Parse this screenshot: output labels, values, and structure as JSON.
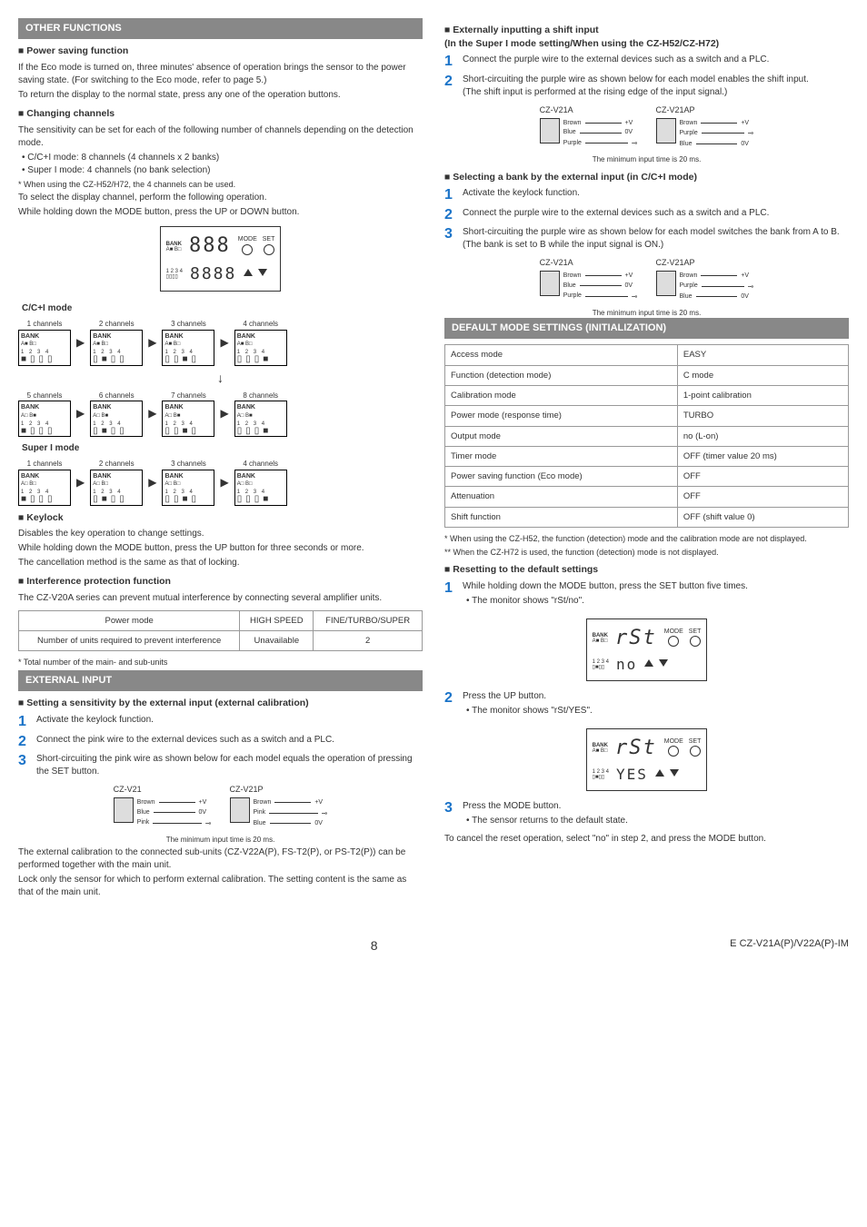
{
  "left": {
    "other_functions": "OTHER FUNCTIONS",
    "power_saving": {
      "title": "Power saving function",
      "p1": "If the Eco mode is turned on, three minutes' absence of operation brings the sensor to the power saving state. (For switching to the Eco mode, refer to page 5.)",
      "p2": "To return the display to the normal state, press any one of the operation buttons."
    },
    "changing_channels": {
      "title": "Changing channels",
      "p1": "The sensitivity can be set for each of the following number of channels depending on the detection mode.",
      "bullets": [
        "C/C+I mode: 8 channels (4 channels x 2 banks)",
        "Super I mode: 4 channels (no bank selection)"
      ],
      "note": "* When using the CZ-H52/H72, the 4 channels can be used.",
      "p2": "To select the display channel, perform the following operation.",
      "p3": "While holding down the MODE button, press the UP or DOWN button.",
      "cci_mode": "C/C+I mode",
      "super_mode": "Super I mode",
      "ch1": "1 channels",
      "ch2": "2 channels",
      "ch3": "3 channels",
      "ch4": "4 channels",
      "ch5": "5 channels",
      "ch6": "6 channels",
      "ch7": "7 channels",
      "ch8": "8 channels",
      "bank": "BANK"
    },
    "keylock": {
      "title": "Keylock",
      "p1": "Disables the key operation to change settings.",
      "p2": "While holding down the MODE button, press the UP button for three seconds or more.",
      "p3": "The cancellation method is the same as that of locking."
    },
    "interference": {
      "title": "Interference protection function",
      "p1": "The CZ-V20A series can prevent mutual interference by connecting several amplifier units.",
      "table": {
        "h1": "Power mode",
        "h2": "HIGH SPEED",
        "h3": "FINE/TURBO/SUPER",
        "r1c1": "Number of units required to prevent interference",
        "r1c2": "Unavailable",
        "r1c3": "2"
      },
      "note": "* Total number of the main- and sub-units"
    },
    "external_input": "EXTERNAL INPUT",
    "setting_sens": {
      "title": "Setting a sensitivity by the external input (external calibration)",
      "s1": "Activate the keylock function.",
      "s2": "Connect the pink wire to the external devices such as a switch and a PLC.",
      "s3": "Short-circuiting the pink wire as shown below for each model equals the operation of pressing the SET button.",
      "wiring": {
        "left_title": "CZ-V21",
        "right_title": "CZ-V21P",
        "brown": "Brown",
        "blue": "Blue",
        "pink": "Pink",
        "plusv": "+V",
        "zerov": "0V",
        "min_time": "The minimum input time is 20 ms."
      },
      "p_after": "The external calibration to the connected sub-units (CZ-V22A(P), FS-T2(P), or PS-T2(P)) can be performed together with the main unit.",
      "p_after2": "Lock only the sensor for which to perform external calibration. The setting content is the same as that of the main unit."
    }
  },
  "right": {
    "ext_shift": {
      "title": "Externally inputting a shift input",
      "subtitle": "(In the Super I mode setting/When using the CZ-H52/CZ-H72)",
      "s1": "Connect the purple wire to the external devices such as a switch and a PLC.",
      "s2": "Short-circuiting the purple wire as shown below for each model enables the shift input.",
      "s2_note": "(The shift input is performed at the rising edge of the input signal.)",
      "wiring": {
        "left_title": "CZ-V21A",
        "right_title": "CZ-V21AP",
        "brown": "Brown",
        "blue": "Blue",
        "purple": "Purple",
        "plusv": "+V",
        "zerov": "0V",
        "min_time": "The minimum input time is 20 ms."
      }
    },
    "select_bank": {
      "title": "Selecting a bank by the external input (in C/C+I mode)",
      "s1": "Activate the keylock function.",
      "s2": "Connect the purple wire to the external devices such as a switch and a PLC.",
      "s3": "Short-circuiting the purple wire as shown below for each model switches the bank from A to B.",
      "s3_note": "(The bank is set to B while the input signal is ON.)",
      "wiring": {
        "left_title": "CZ-V21A",
        "right_title": "CZ-V21AP",
        "brown": "Brown",
        "blue": "Blue",
        "purple": "Purple",
        "plusv": "+V",
        "zerov": "0V",
        "min_time": "The minimum input time is 20 ms."
      }
    },
    "defaults": {
      "header": "DEFAULT MODE SETTINGS (INITIALIZATION)",
      "rows": [
        [
          "Access mode",
          "EASY"
        ],
        [
          "Function (detection mode)",
          "C mode"
        ],
        [
          "Calibration mode",
          "1-point calibration"
        ],
        [
          "Power mode (response time)",
          "TURBO"
        ],
        [
          "Output mode",
          "no (L-on)"
        ],
        [
          "Timer mode",
          "OFF (timer value 20 ms)"
        ],
        [
          "Power saving function (Eco mode)",
          "OFF"
        ],
        [
          "Attenuation",
          "OFF"
        ],
        [
          "Shift function",
          "OFF (shift value 0)"
        ]
      ],
      "note1": "* When using the CZ-H52, the function (detection) mode and the calibration mode are not displayed.",
      "note2": "** When the CZ-H72 is used, the function (detection) mode is not displayed."
    },
    "resetting": {
      "title": "Resetting to the default settings",
      "s1": "While holding down the MODE button, press the SET button five times.",
      "s1_b": "The monitor shows \"rSt/no\".",
      "s2": "Press the UP button.",
      "s2_b": "The monitor shows \"rSt/YES\".",
      "s3": "Press the MODE button.",
      "s3_b": "The sensor returns to the default state.",
      "cancel": "To cancel the reset operation, select \"no\" in step 2, and press the MODE button.",
      "disp1_top": "rSt",
      "disp1_bot": "no",
      "disp2_top": "rSt",
      "disp2_bot": "YES",
      "mode_lbl": "MODE",
      "set_lbl": "SET",
      "bank_lbl": "BANK"
    }
  },
  "footer": {
    "page": "8",
    "doc": "E CZ-V21A(P)/V22A(P)-IM"
  }
}
